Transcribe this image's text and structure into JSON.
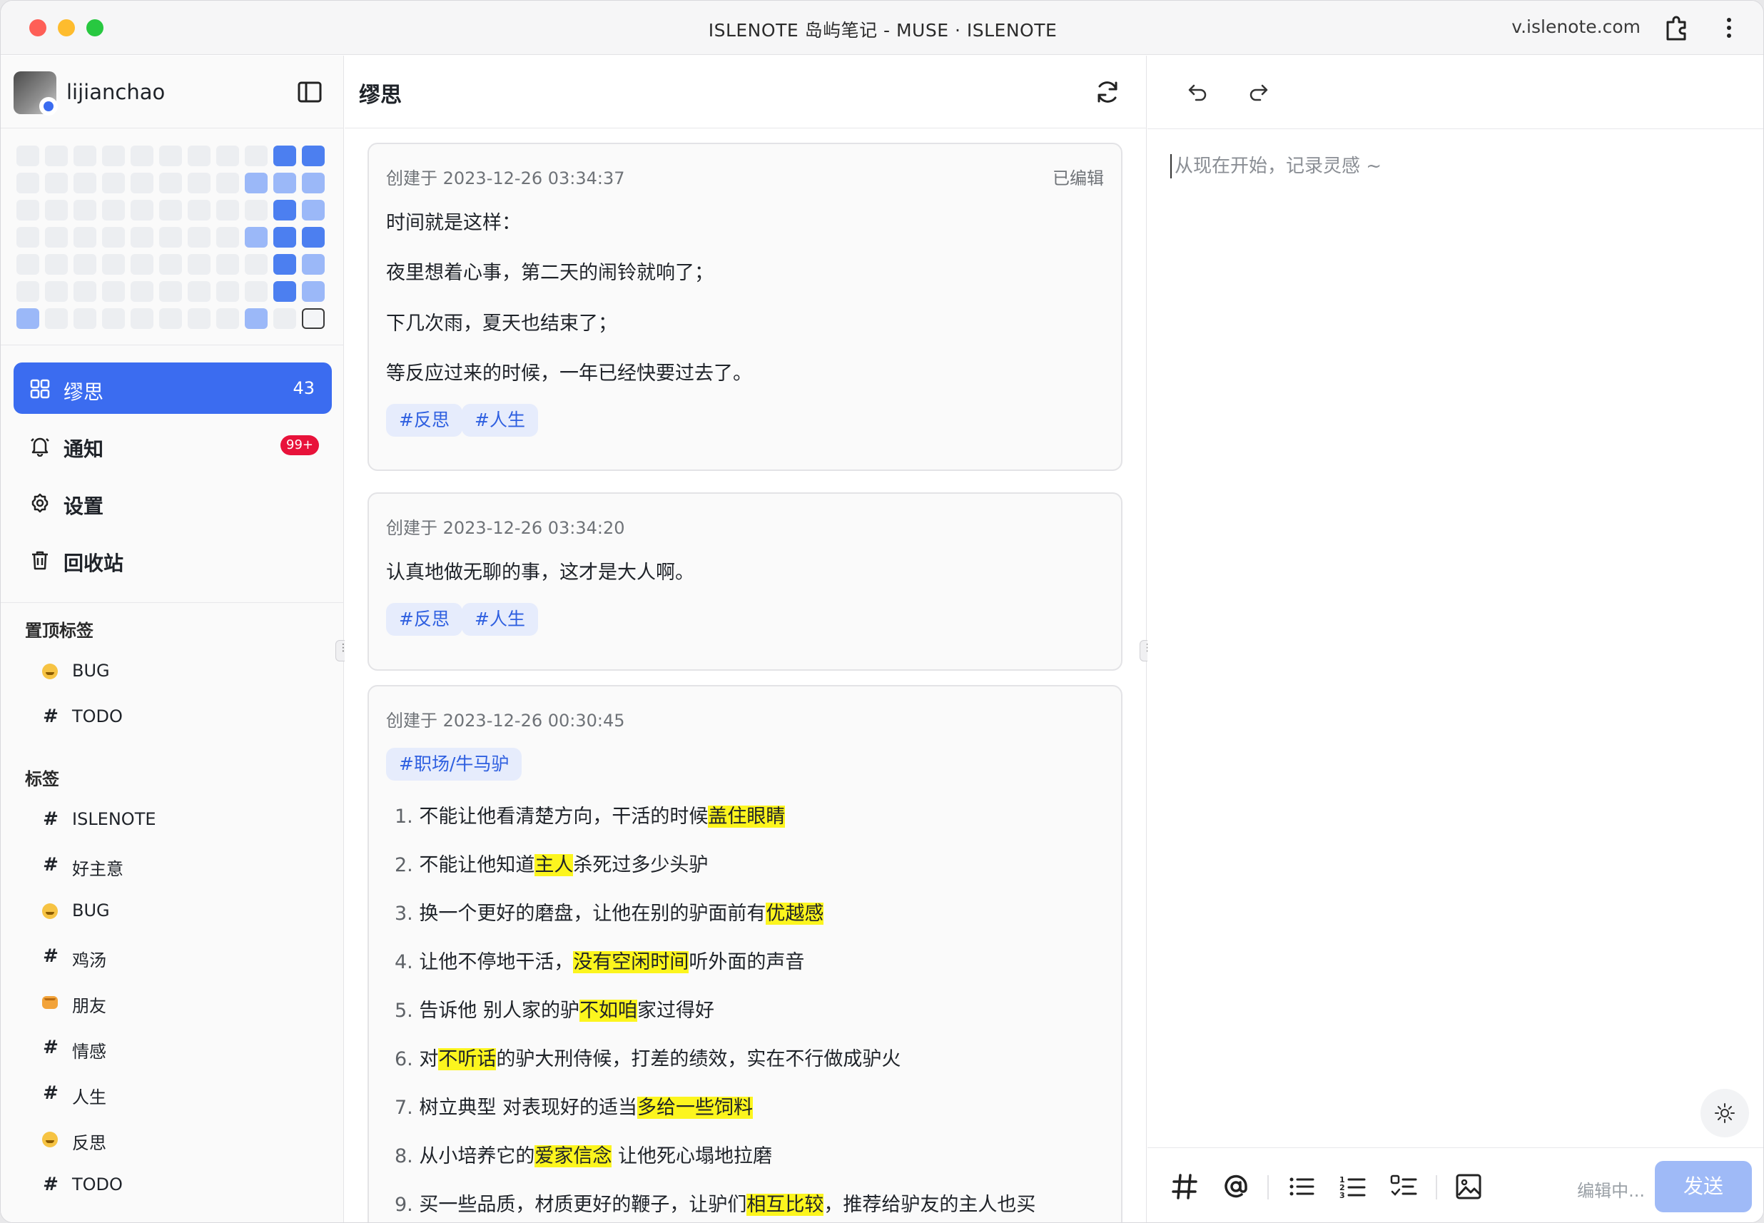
{
  "window": {
    "title": "ISLENOTE 岛屿笔记 - MUSE · ISLENOTE",
    "url": "v.islenote.com"
  },
  "sidebar": {
    "username": "lijianchao",
    "nav": [
      {
        "label": "缪思",
        "count": "43",
        "icon": "grid-icon",
        "active": true
      },
      {
        "label": "通知",
        "badge": "99+",
        "icon": "bell-icon"
      },
      {
        "label": "设置",
        "icon": "gear-icon"
      },
      {
        "label": "回收站",
        "icon": "trash-icon"
      }
    ],
    "pinned_title": "置顶标签",
    "pinned": [
      {
        "label": "BUG",
        "icon": "emoji-face-icon"
      },
      {
        "label": "TODO",
        "icon": "hash-icon"
      }
    ],
    "tags_title": "标签",
    "tags": [
      {
        "label": "ISLENOTE",
        "icon": "hash-icon"
      },
      {
        "label": "好主意",
        "icon": "hash-icon"
      },
      {
        "label": "BUG",
        "icon": "emoji-face-icon"
      },
      {
        "label": "鸡汤",
        "icon": "hash-icon"
      },
      {
        "label": "朋友",
        "icon": "emoji-fist-icon"
      },
      {
        "label": "情感",
        "icon": "hash-icon"
      },
      {
        "label": "人生",
        "icon": "hash-icon"
      },
      {
        "label": "反思",
        "icon": "emoji-thinking-icon"
      },
      {
        "label": "TODO",
        "icon": "hash-icon"
      }
    ],
    "heatmap_rows": [
      [
        0,
        0,
        0,
        0,
        0,
        0,
        0,
        0,
        0,
        3,
        3
      ],
      [
        0,
        0,
        0,
        0,
        0,
        0,
        0,
        0,
        2,
        2,
        2
      ],
      [
        0,
        0,
        0,
        0,
        0,
        0,
        0,
        0,
        0,
        3,
        2
      ],
      [
        0,
        0,
        0,
        0,
        0,
        0,
        0,
        0,
        2,
        3,
        3
      ],
      [
        0,
        0,
        0,
        0,
        0,
        0,
        0,
        0,
        0,
        3,
        2
      ],
      [
        0,
        0,
        0,
        0,
        0,
        0,
        0,
        0,
        0,
        3,
        2
      ],
      [
        2,
        0,
        0,
        0,
        0,
        0,
        0,
        0,
        2,
        0,
        4
      ]
    ],
    "colors": {
      "active": "#3b6cf0",
      "badge": "#e8123a",
      "heat_low": "#9bb8f8",
      "heat_high": "#4c7ff0"
    }
  },
  "middle": {
    "title": "缪思",
    "cards": [
      {
        "meta": "创建于 2023-12-26 03:34:37",
        "edited": "已编辑",
        "lines": [
          "时间就是这样：",
          "夜里想着心事，第二天的闹铃就响了；",
          "下几次雨，夏天也结束了；",
          "等反应过来的时候，一年已经快要过去了。"
        ],
        "tags": [
          "#反思",
          "#人生"
        ]
      },
      {
        "meta": "创建于 2023-12-26 03:34:20",
        "lines": [
          "认真地做无聊的事，这才是大人啊。"
        ],
        "tags": [
          "#反思",
          "#人生"
        ]
      },
      {
        "meta": "创建于 2023-12-26 00:30:45",
        "tags": [
          "#职场/牛马驴"
        ],
        "list": [
          {
            "num": "1.",
            "pre": "不能让他看清楚方向，干活的时候",
            "hl": "盖住眼睛",
            "post": ""
          },
          {
            "num": "2.",
            "pre": "不能让他知道",
            "hl": "主人",
            "post": "杀死过多少头驴"
          },
          {
            "num": "3.",
            "pre": "换一个更好的磨盘，让他在别的驴面前有",
            "hl": "优越感",
            "post": ""
          },
          {
            "num": "4.",
            "pre": "让他不停地干活，",
            "hl": "没有空闲时间",
            "post": "听外面的声音"
          },
          {
            "num": "5.",
            "pre": "告诉他 别人家的驴",
            "hl": "不如咱",
            "post": "家过得好"
          },
          {
            "num": "6.",
            "pre": "对",
            "hl": "不听话",
            "post": "的驴大刑侍候，打差的绩效，实在不行做成驴火"
          },
          {
            "num": "7.",
            "pre": "树立典型 对表现好的适当",
            "hl": "多给一些饲料",
            "post": ""
          },
          {
            "num": "8.",
            "pre": "从小培养它的",
            "hl": "爱家信念",
            "post": " 让他死心塌地拉磨"
          },
          {
            "num": "9.",
            "pre": "买一些品质，材质更好的鞭子，让驴们",
            "hl": "相互比较",
            "post": "，推荐给驴友的主人也买"
          }
        ]
      }
    ]
  },
  "right": {
    "placeholder": "从现在开始，记录灵感 ~",
    "status": "编辑中...",
    "send": "发送"
  }
}
